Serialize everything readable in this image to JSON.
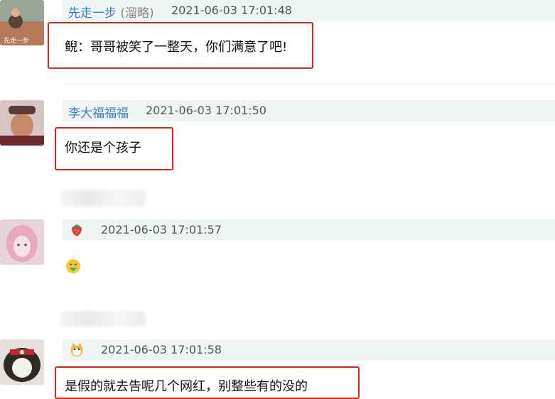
{
  "comments": [
    {
      "username": "先走一步",
      "tag": "(溜略)",
      "time": "2021-06-03 17:01:48",
      "message": "鲵：哥哥被笑了一整天，你们满意了吧!",
      "avatar_overlay": "先走一步"
    },
    {
      "username": "李大福福福",
      "time": "2021-06-03 17:01:50",
      "message": "你还是个孩子"
    },
    {
      "username_icon": "strawberry-icon",
      "time": "2021-06-03 17:01:57",
      "message_emoji": "vomiting-face-emoji"
    },
    {
      "username_icon": "cat-face-icon",
      "time": "2021-06-03 17:01:58",
      "message": "是假的就去告呢几个网红，别整些有的没的"
    }
  ],
  "colors": {
    "username": "#3c7ec9",
    "highlight_box": "#e2231a",
    "header_bg": "#eef5f3"
  }
}
